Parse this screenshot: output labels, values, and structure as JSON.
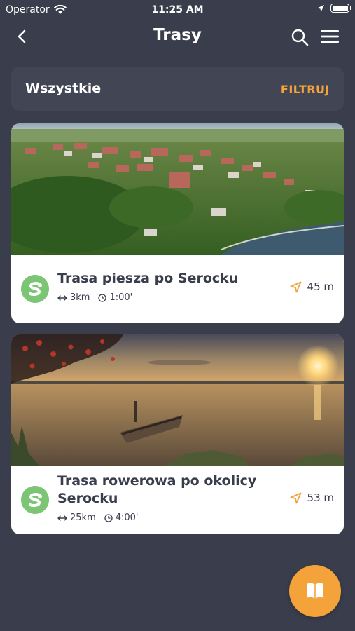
{
  "status_bar": {
    "carrier": "Operator",
    "time": "11:25 AM"
  },
  "nav": {
    "title": "Trasy",
    "back_icon": "chevron-left-icon",
    "search_icon": "search-icon",
    "menu_icon": "hamburger-menu-icon"
  },
  "filter": {
    "label": "Wszystkie",
    "button": "FILTRUJ"
  },
  "routes": [
    {
      "title": "Trasa piesza po Serocku",
      "distance": "3km",
      "duration": "1:00'",
      "proximity": "45 m",
      "image": "aerial-town-photo"
    },
    {
      "title": "Trasa rowerowa po okolicy Serocku",
      "distance": "25km",
      "duration": "4:00'",
      "proximity": "53 m",
      "image": "lake-sunset-boat-photo"
    }
  ],
  "colors": {
    "background": "#3a3d4c",
    "accent": "#f3a33a",
    "route_icon": "#7cc575",
    "card": "#ffffff"
  },
  "fab": {
    "icon": "map-book-icon"
  }
}
